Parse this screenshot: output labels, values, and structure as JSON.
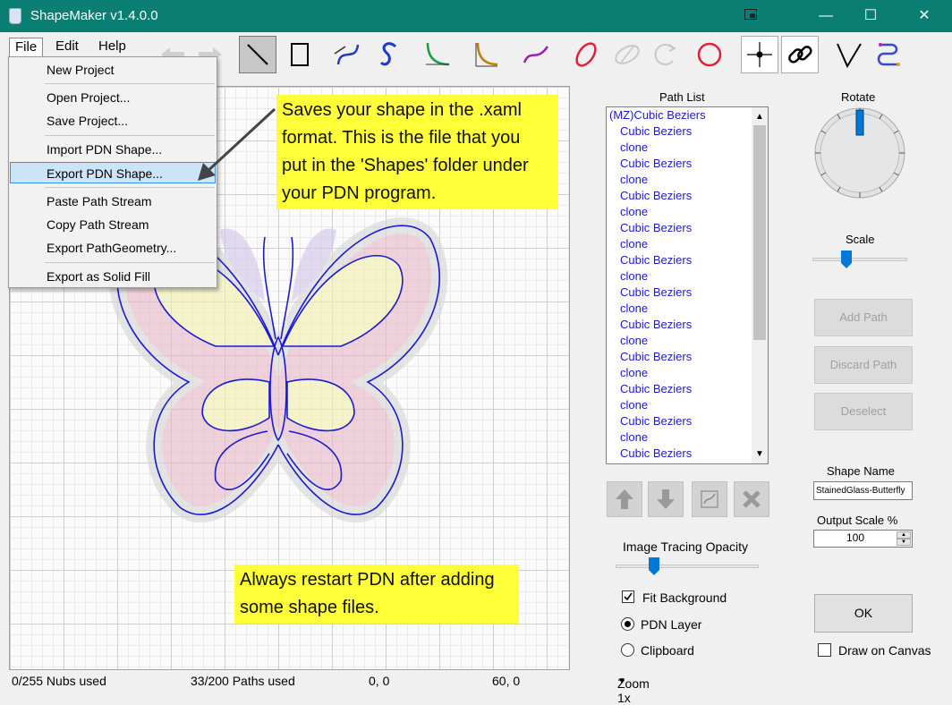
{
  "window": {
    "title": "ShapeMaker v1.4.0.0",
    "min_glyph": "—",
    "max_glyph": "☐",
    "close_glyph": "✕"
  },
  "menu": {
    "file": "File",
    "edit": "Edit",
    "help": "Help"
  },
  "file_menu": {
    "items": [
      "New Project",
      "Open Project...",
      "Save Project...",
      "Import PDN Shape...",
      "Export PDN Shape...",
      "Paste Path Stream",
      "Copy Path Stream",
      "Export PathGeometry...",
      "Export as Solid Fill"
    ],
    "highlighted": "Export PDN Shape..."
  },
  "toolbar": {
    "tools": [
      "undo-icon",
      "redo-icon",
      "line-tool-icon",
      "rectangle-tool-icon",
      "cubic-bezier-icon",
      "smooth-cubic-icon",
      "quadratic-icon",
      "smooth-quadratic-icon",
      "spline-icon",
      "ellipse-icon",
      "ellipse-arc-icon",
      "arc-icon",
      "circle-icon",
      "snap-icon",
      "link-icon",
      "v-path-icon",
      "loop-path-icon"
    ]
  },
  "notes": {
    "top": [
      "Saves your shape in the .xaml",
      "format. This is the file that you",
      "put in the 'Shapes' folder under",
      "your PDN program."
    ],
    "bottom": [
      "Always restart PDN after adding",
      "some shape files."
    ]
  },
  "path_list": {
    "title": "Path List",
    "items": [
      "(MZ)Cubic Beziers",
      "Cubic Beziers",
      "clone",
      "Cubic Beziers",
      "clone",
      "Cubic Beziers",
      "clone",
      "Cubic Beziers",
      "clone",
      "Cubic Beziers",
      "clone",
      "Cubic Beziers",
      "clone",
      "Cubic Beziers",
      "clone",
      "Cubic Beziers",
      "clone",
      "Cubic Beziers",
      "clone",
      "Cubic Beziers",
      "clone",
      "Cubic Beziers"
    ]
  },
  "right_panel": {
    "rotate_label": "Rotate",
    "scale_label": "Scale",
    "add_path": "Add Path",
    "discard_path": "Discard Path",
    "deselect": "Deselect",
    "shape_name_label": "Shape Name",
    "shape_name_value": "StainedGlass-Butterfly",
    "output_scale_label": "Output Scale %",
    "output_scale_value": "100",
    "ok": "OK",
    "draw_on_canvas": "Draw on Canvas"
  },
  "tracing": {
    "opacity_label": "Image Tracing Opacity",
    "fit_background": "Fit Background",
    "fit_background_checked": true,
    "pdn_layer": "PDN Layer",
    "clipboard": "Clipboard",
    "selected_source": "PDN Layer"
  },
  "status": {
    "nubs": "0/255 Nubs used",
    "paths": "33/200 Paths used",
    "coord1": "0, 0",
    "coord2": "60, 0",
    "zoom": "Zoom 1x"
  },
  "colors": {
    "titlebar": "#0a7e73",
    "accent": "#0078d7",
    "path_stroke": "#1a1ad0",
    "note_bg": "#ffff3a"
  }
}
